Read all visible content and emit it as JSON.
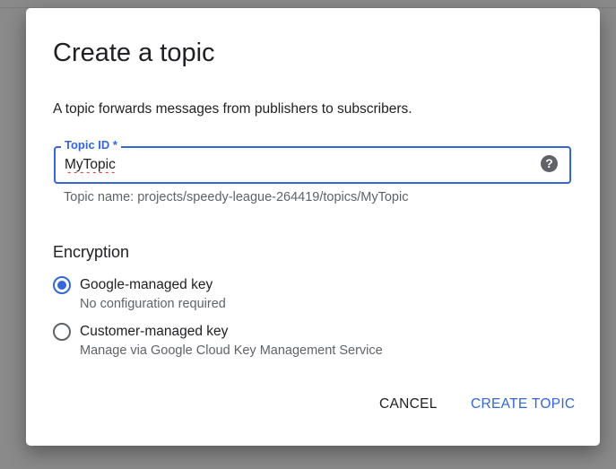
{
  "dialog": {
    "title": "Create a topic",
    "description": "A topic forwards messages from publishers to subscribers.",
    "topic_id": {
      "label": "Topic ID *",
      "value": "MyTopic",
      "help_icon": "help-circle-icon",
      "hint": "Topic name: projects/speedy-league-264419/topics/MyTopic"
    },
    "encryption": {
      "title": "Encryption",
      "options": [
        {
          "label": "Google-managed key",
          "description": "No configuration required",
          "selected": true
        },
        {
          "label": "Customer-managed key",
          "description": "Manage via Google Cloud Key Management Service",
          "selected": false
        }
      ]
    },
    "actions": {
      "cancel_label": "CANCEL",
      "create_label": "CREATE TOPIC"
    }
  },
  "colors": {
    "accent": "#3367d6",
    "text_primary": "#202124",
    "text_secondary": "#5f6368",
    "backdrop": "#8a8a8a"
  }
}
